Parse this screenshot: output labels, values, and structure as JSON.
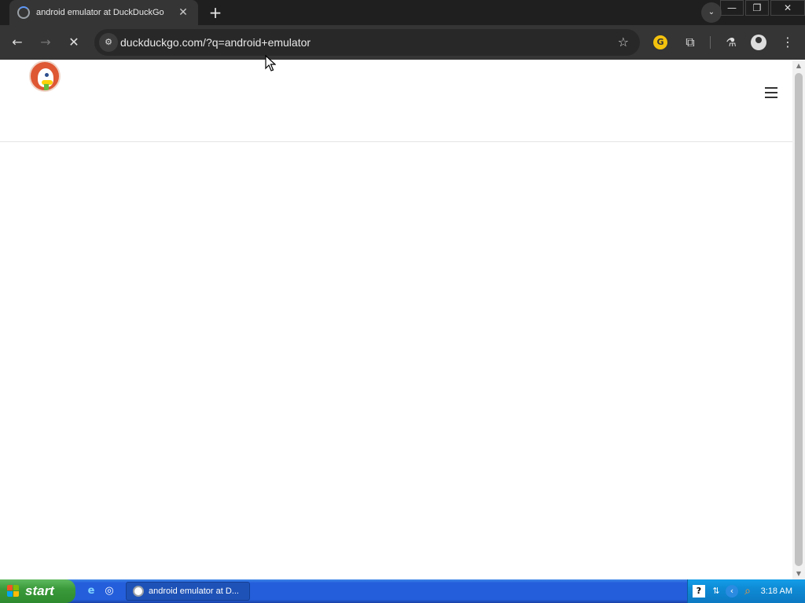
{
  "browser": {
    "tab": {
      "title": "android emulator at DuckDuckGo",
      "close": "✕"
    },
    "new_tab": "+",
    "tab_search": "⌄",
    "window_controls": {
      "minimize": "—",
      "restore": "❐",
      "close": "✕"
    },
    "toolbar": {
      "back": "←",
      "forward": "→",
      "stop": "✕",
      "site_info": "⚙",
      "url": "duckduckgo.com/?q=android+emulator",
      "bookmark": "☆",
      "extension_label": "G",
      "extensions": "⧉",
      "labs": "⚗",
      "menu": "⋮"
    }
  },
  "scrollbar": {
    "up": "▲",
    "down": "▼"
  },
  "taskbar": {
    "start_label": "start",
    "task_item_title": "android emulator at D...",
    "quick_launch": [
      "e",
      "◎"
    ],
    "tray": {
      "help": "?",
      "net": "⇅",
      "arrow": "‹",
      "search": "⌕"
    },
    "clock": "3:18 AM"
  }
}
